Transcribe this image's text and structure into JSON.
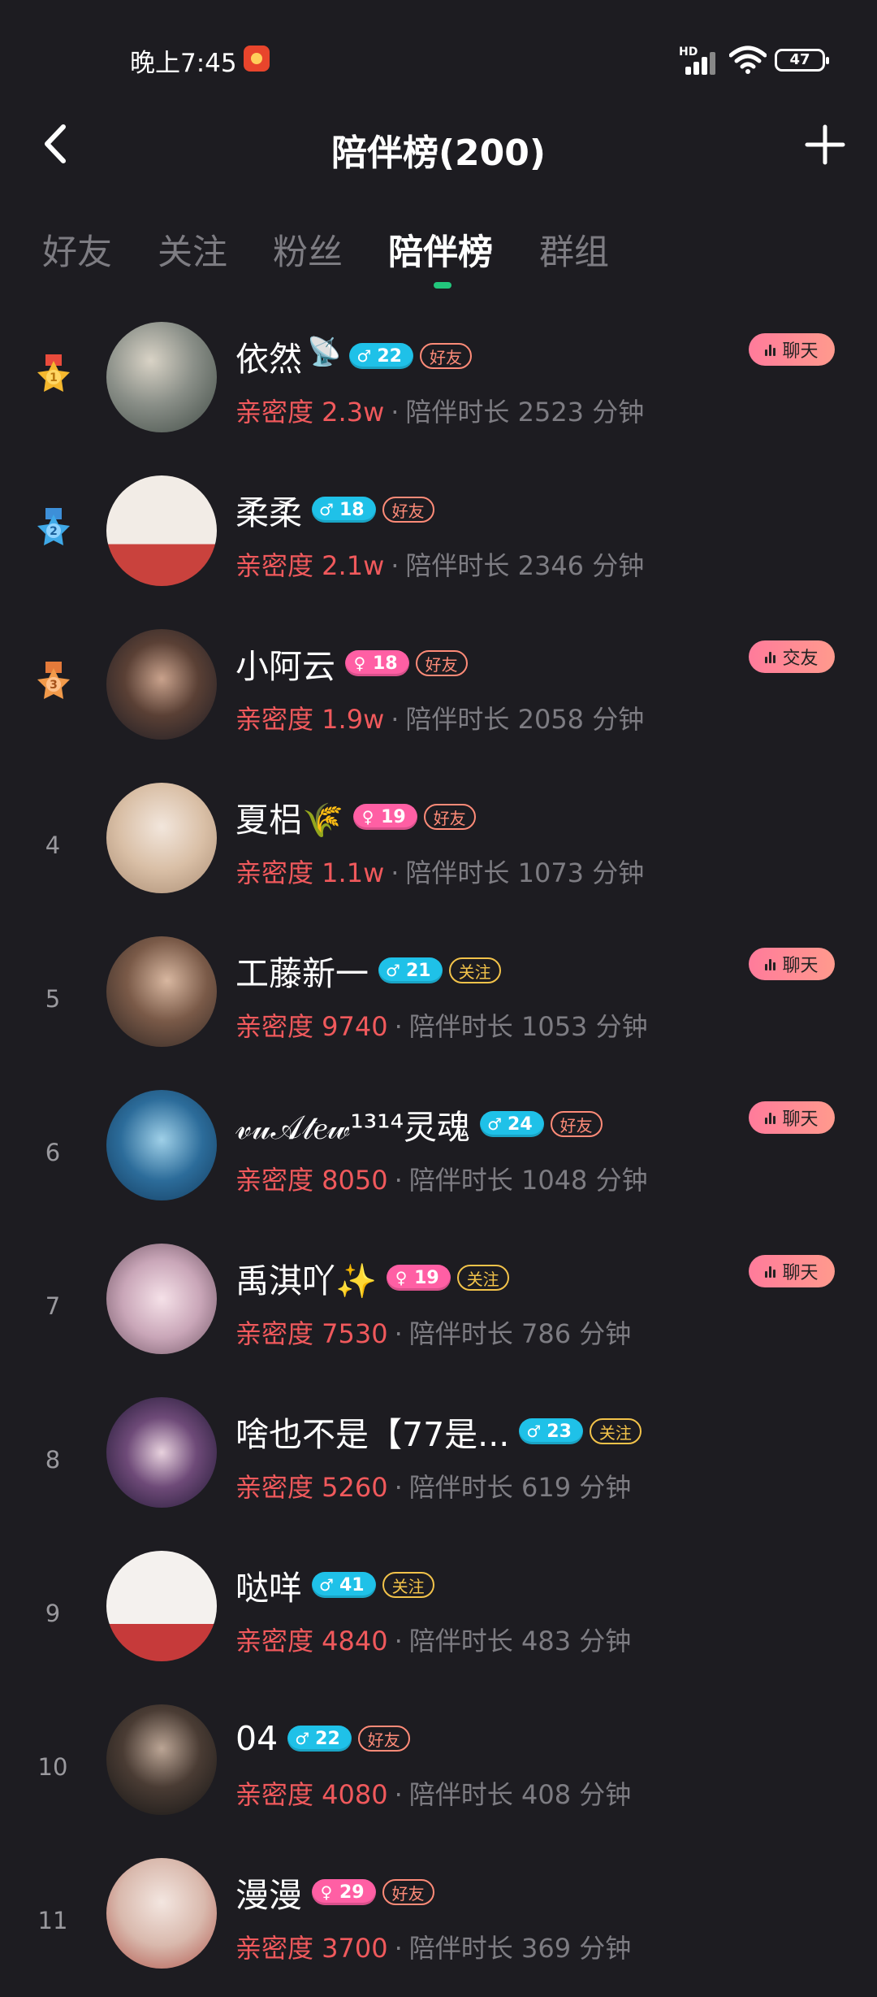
{
  "status_bar": {
    "time": "晚上7:45",
    "network": "HD",
    "battery": "47"
  },
  "header": {
    "title": "陪伴榜(200)"
  },
  "tabs": [
    {
      "label": "好友",
      "active": false
    },
    {
      "label": "关注",
      "active": false
    },
    {
      "label": "粉丝",
      "active": false
    },
    {
      "label": "陪伴榜",
      "active": true
    },
    {
      "label": "群组",
      "active": false
    }
  ],
  "colors": {
    "background": "#1d1c21",
    "accent": "#22c67c",
    "intimacy": "#f0595c",
    "male": "#1fc1e8",
    "female": "#ff5fa4",
    "friend_badge": "#ff8b78",
    "follow_badge": "#f3c34a"
  },
  "list": [
    {
      "rank": "1",
      "medal": "gold-medal-icon",
      "name": "依然",
      "gender": "male",
      "age": "22",
      "relation": "好友",
      "intimacy": "亲密度 2.3w",
      "duration": "陪伴时长 2523 分钟",
      "action": "聊天"
    },
    {
      "rank": "2",
      "medal": "silver-medal-icon",
      "name": "柔柔",
      "gender": "male",
      "age": "18",
      "relation": "好友",
      "intimacy": "亲密度 2.1w",
      "duration": "陪伴时长 2346 分钟",
      "action": ""
    },
    {
      "rank": "3",
      "medal": "bronze-medal-icon",
      "name": "小阿云",
      "gender": "female",
      "age": "18",
      "relation": "好友",
      "intimacy": "亲密度 1.9w",
      "duration": "陪伴时长 2058 分钟",
      "action": "交友"
    },
    {
      "rank": "4",
      "medal": "",
      "name": "夏梠🌾",
      "gender": "female",
      "age": "19",
      "relation": "好友",
      "intimacy": "亲密度 1.1w",
      "duration": "陪伴时长 1073 分钟",
      "action": ""
    },
    {
      "rank": "5",
      "medal": "",
      "name": "工藤新一",
      "gender": "male",
      "age": "21",
      "relation": "关注",
      "intimacy": "亲密度 9740",
      "duration": "陪伴时长 1053 分钟",
      "action": "聊天"
    },
    {
      "rank": "6",
      "medal": "",
      "name": "𝓋𝓊𝒜𝓉𝑒𝓌¹³¹⁴灵魂",
      "gender": "male",
      "age": "24",
      "relation": "好友",
      "intimacy": "亲密度 8050",
      "duration": "陪伴时长 1048 分钟",
      "action": "聊天"
    },
    {
      "rank": "7",
      "medal": "",
      "name": "禹淇吖✨",
      "gender": "female",
      "age": "19",
      "relation": "关注",
      "intimacy": "亲密度 7530",
      "duration": "陪伴时长 786 分钟",
      "action": "聊天"
    },
    {
      "rank": "8",
      "medal": "",
      "name": "啥也不是【77是...",
      "gender": "male",
      "age": "23",
      "relation": "关注",
      "intimacy": "亲密度 5260",
      "duration": "陪伴时长 619 分钟",
      "action": ""
    },
    {
      "rank": "9",
      "medal": "",
      "name": "哒咩",
      "gender": "male",
      "age": "41",
      "relation": "关注",
      "intimacy": "亲密度 4840",
      "duration": "陪伴时长 483 分钟",
      "action": ""
    },
    {
      "rank": "10",
      "medal": "",
      "name": "04",
      "gender": "male",
      "age": "22",
      "relation": "好友",
      "intimacy": "亲密度 4080",
      "duration": "陪伴时长 408 分钟",
      "action": ""
    },
    {
      "rank": "11",
      "medal": "",
      "name": "漫漫",
      "gender": "female",
      "age": "29",
      "relation": "好友",
      "intimacy": "亲密度 3700",
      "duration": "陪伴时长 369 分钟",
      "action": ""
    }
  ]
}
